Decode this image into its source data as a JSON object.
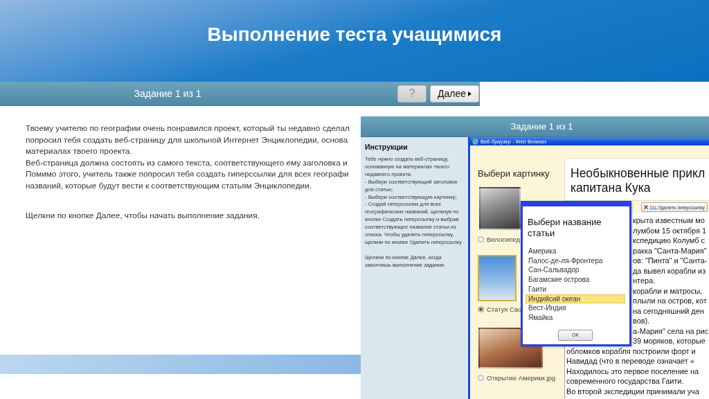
{
  "slide": {
    "title": "Выполнение теста учащимися"
  },
  "task_screen": {
    "toolbar": {
      "counter": "Задание 1 из 1",
      "buttons": [
        {
          "kind": "help",
          "label": "?",
          "disabled": true
        },
        {
          "kind": "next",
          "label": "Далее",
          "disabled": false
        }
      ]
    },
    "description_lines": [
      "Твоему учителю по географии очень понравился проект, который ты недавно сделал",
      "попросил тебя создать веб-страницу для школьной Интернет Энциклопедии, основа",
      "материалах твоего проекта.",
      "Веб-страница должна состоять из самого текста, соответствующего ему заголовка и",
      "Помимо этого, учитель также попросил тебя создать гиперссылки для всех географи",
      "названий, которые будут вести к соответствующим статьям Энциклопедии."
    ],
    "prompt": "Щелкни по кнопке Далее, чтобы начать выполнение задания."
  },
  "work_screen": {
    "counter": "Задание 1 из 1",
    "instructions": {
      "title": "Инструкции",
      "lines": [
        "Тебе нужно создать веб-страницу, основанную на материалах твоего недавнего проекта.",
        "- Выбери соответствующий заголовок для статьи;",
        "- Выбери соответствующую картинку;",
        "- Создай гиперссылки для всех географических названий, щелкнув по кнопке Создать гиперссылку и выбрав соответствующее название статьи из списка. Чтобы удалить гиперссылку, щелкни по кнопке Удалить гиперссылку"
      ],
      "closing": "Щелкни по кнопке Далее, когда закончишь выполнение задания."
    },
    "browser": {
      "title": "Веб-браузер - Web Browser",
      "picture_panel": {
        "title": "Выбери картинку",
        "pictures": [
          {
            "label": "Велосипед",
            "selected": false
          },
          {
            "label": "Статуя Сво",
            "selected": true
          },
          {
            "label": "Открытие Америки.jpg",
            "selected": false
          }
        ]
      },
      "heading_lines": [
        "Необыкновенные прикл",
        "капитана Кука"
      ],
      "toolbar_buttons": [
        {
          "kind": "remove_link",
          "label": "Удалить гиперссылку"
        }
      ],
      "article": {
        "lines_beside_dialog": [
          "крыта известным мо",
          "лумбом 15 октября 1",
          "кспедицию Колумб с",
          "ракка \"Санта-Мария\"",
          "ов: \"Пинта\" и \"Санта-",
          "да вывел корабли из",
          "нтера.",
          "корабли и матросы,",
          "плыли на остров, кот",
          "на сегодняшний ден",
          "вов).",
          "а-Мария\" села на рис",
          "39 моряков, которые"
        ],
        "lines": [
          "обломков корабля построили форт и",
          "Навидад (что в переводе означает «",
          "Находилось это первое поселение на",
          "современного государства Гаити.",
          "Во второй экспедиции принимали уча"
        ]
      },
      "dialog": {
        "title": "Выбери название статьи",
        "options": [
          {
            "label": "Америка",
            "selected": false
          },
          {
            "label": "Палос-де-ля-Фронтера",
            "selected": false
          },
          {
            "label": "Сан-Сальвадор",
            "selected": false
          },
          {
            "label": "Багамские острова",
            "selected": false
          },
          {
            "label": "Гаити",
            "selected": false
          },
          {
            "label": "Индийсий океан",
            "selected": true
          },
          {
            "label": "Вест-Индия",
            "selected": false
          },
          {
            "label": "Ямайка",
            "selected": false
          }
        ],
        "button": "OK"
      }
    }
  }
}
